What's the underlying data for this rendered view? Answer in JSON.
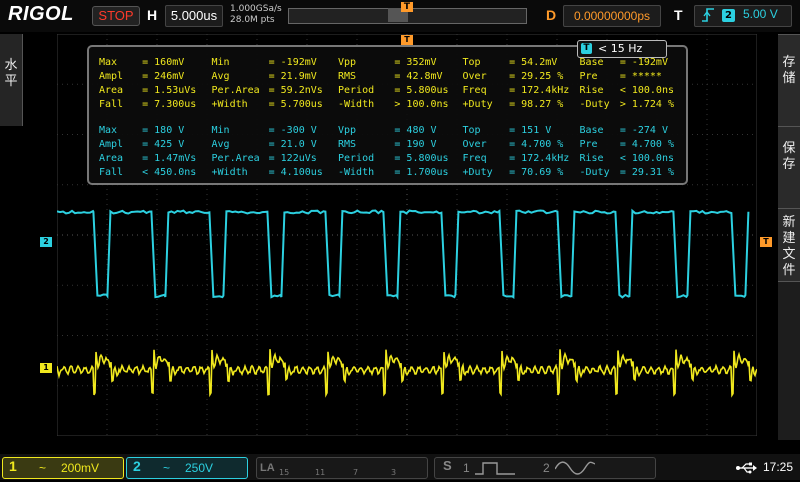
{
  "brand": "RIGOL",
  "run_state": "STOP",
  "horizontal": {
    "label": "H",
    "timebase": "5.000us",
    "sample_rate": "1.000GSa/s",
    "memory_depth": "28.0M pts"
  },
  "delay": {
    "label": "D",
    "value": "0.00000000ps"
  },
  "trigger": {
    "label": "T",
    "edge_icon": "rising-edge-icon",
    "channel": "2",
    "level": "5.00 V"
  },
  "left_panel": {
    "text": "水平"
  },
  "right_panel": {
    "top": "存储",
    "middle": "保存",
    "bottom": "新建文件"
  },
  "freq_counter": {
    "channel": "T",
    "text": "< 15 Hz"
  },
  "measurements": {
    "ch1": [
      [
        "Max",
        "= 160mV",
        "Min",
        "= -192mV",
        "Vpp",
        "= 352mV",
        "Top",
        "= 54.2mV",
        "Base",
        "= -192mV"
      ],
      [
        "Ampl",
        "= 246mV",
        "Avg",
        "= 21.9mV",
        "RMS",
        "= 42.8mV",
        "Over",
        "= 29.25 %",
        "Pre",
        "= *****"
      ],
      [
        "Area",
        "= 1.53uVs",
        "Per.Area",
        "= 59.2nVs",
        "Period",
        "= 5.800us",
        "Freq",
        "= 172.4kHz",
        "Rise",
        "< 100.0ns"
      ],
      [
        "Fall",
        "= 7.300us",
        "+Width",
        "= 5.700us",
        "-Width",
        "> 100.0ns",
        "+Duty",
        "= 98.27 %",
        "-Duty",
        "> 1.724 %"
      ]
    ],
    "ch2": [
      [
        "Max",
        "= 180 V",
        "Min",
        "= -300 V",
        "Vpp",
        "= 480 V",
        "Top",
        "= 151 V",
        "Base",
        "= -274 V"
      ],
      [
        "Ampl",
        "= 425 V",
        "Avg",
        "= 21.0 V",
        "RMS",
        "= 190 V",
        "Over",
        "= 4.700 %",
        "Pre",
        "= 4.700 %"
      ],
      [
        "Area",
        "= 1.47mVs",
        "Per.Area",
        "= 122uVs",
        "Period",
        "= 5.800us",
        "Freq",
        "= 172.4kHz",
        "Rise",
        "< 100.0ns"
      ],
      [
        "Fall",
        "< 450.0ns",
        "+Width",
        "= 4.100us",
        "-Width",
        "= 1.700us",
        "+Duty",
        "= 70.69 %",
        "-Duty",
        "= 29.31 %"
      ]
    ]
  },
  "channel_markers": {
    "ch1": "1",
    "ch2": "2",
    "trigger": "T"
  },
  "bottom": {
    "ch1": {
      "num": "1",
      "coupling": "~",
      "scale": "200mV"
    },
    "ch2": {
      "num": "2",
      "coupling": "~",
      "scale": "250V"
    },
    "la": {
      "label": "LA",
      "digits": [
        "15",
        "11",
        "7",
        "3"
      ]
    },
    "s_label": "S",
    "s1": "1",
    "s2": "2",
    "usb_icon": "usb-icon",
    "clock": "17:25"
  },
  "colors": {
    "ch1": "#f0e81e",
    "ch2": "#2cd0e0",
    "trigger": "#ff9a2a",
    "stop": "#ff3a2a"
  },
  "waveforms": {
    "period_us": 5.8,
    "ch2_duty": 0.7069
  }
}
